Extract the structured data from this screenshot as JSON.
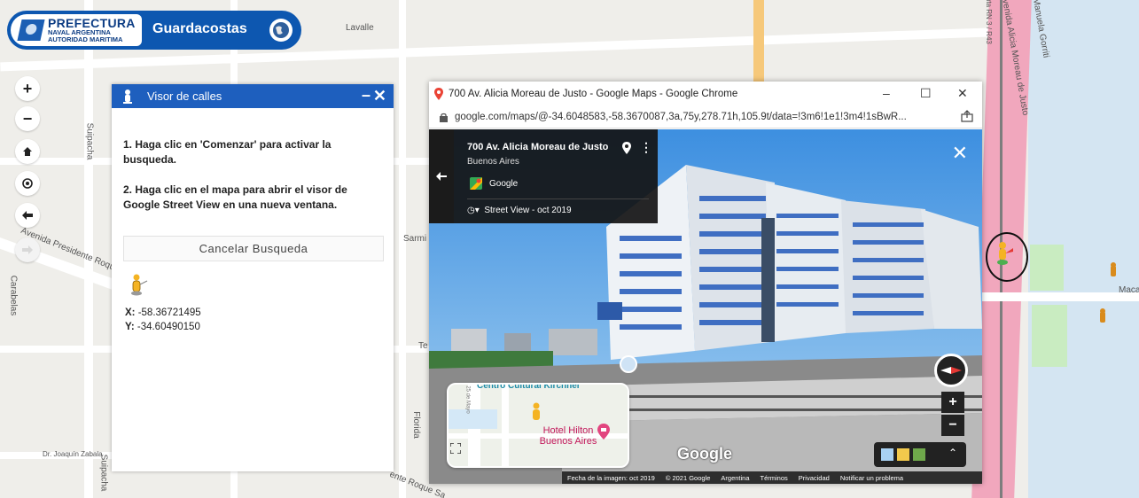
{
  "header": {
    "logo_line1": "PREFECTURA",
    "logo_line2": "NAVAL ARGENTINA",
    "logo_line3": "AUTORIDAD MARITIMA",
    "app_title": "Guardacostas"
  },
  "map": {
    "streets": [
      "Lavalle",
      "Suipacha",
      "Avenida Presidente Roque S",
      "Carabelas",
      "Sarmi",
      "Te",
      "Florida",
      "Dr. Joaquín Zabala",
      "Suipacha",
      "ente Roque Sa",
      "Avenida Alicia Moreau de Justo",
      "Manuela Gorriti",
      "Ruta RN 3 / R43",
      "Maca"
    ],
    "controls": {
      "zoom_in": "+",
      "zoom_out": "−"
    }
  },
  "visor": {
    "title": "Visor de calles",
    "minimize": "–",
    "close": "✕",
    "instruction1": "1. Haga clic en 'Comenzar' para activar la busqueda.",
    "instruction2": "2. Haga clic en el mapa para abrir el visor de Google Street View en una nueva ventana.",
    "cancel_button": "Cancelar Busqueda",
    "x_label": "X:",
    "x_value": "-58.36721495",
    "y_label": "Y:",
    "y_value": "-34.60490150"
  },
  "chrome": {
    "window_title": "700 Av. Alicia Moreau de Justo - Google Maps - Google Chrome",
    "url": "google.com/maps/@-34.6048583,-58.3670087,3a,75y,278.71h,105.9t/data=!3m6!1e1!3m4!1sBwR...",
    "min_btn": "–",
    "max_btn": "☐",
    "close_btn": "✕"
  },
  "streetview": {
    "address": "700 Av. Alicia Moreau de Justo",
    "city": "Buenos Aires",
    "provider": "Google",
    "history": "Street View - oct 2019",
    "close": "✕",
    "minimap_center": "Centro Cultural Kirchner",
    "minimap_hotel": "Hotel Hilton Buenos Aires",
    "minimap_street": "25 de Mayo",
    "google_logo": "Google",
    "footer": [
      "Fecha de la imagen: oct 2019",
      "© 2021 Google",
      "Argentina",
      "Términos",
      "Privacidad",
      "Notificar un problema"
    ]
  },
  "colors": {
    "brand_blue": "#0d57b0",
    "panel_header": "#1e5fbe",
    "avenue_pink": "#f1a7bd",
    "water": "#d4e5f2"
  }
}
